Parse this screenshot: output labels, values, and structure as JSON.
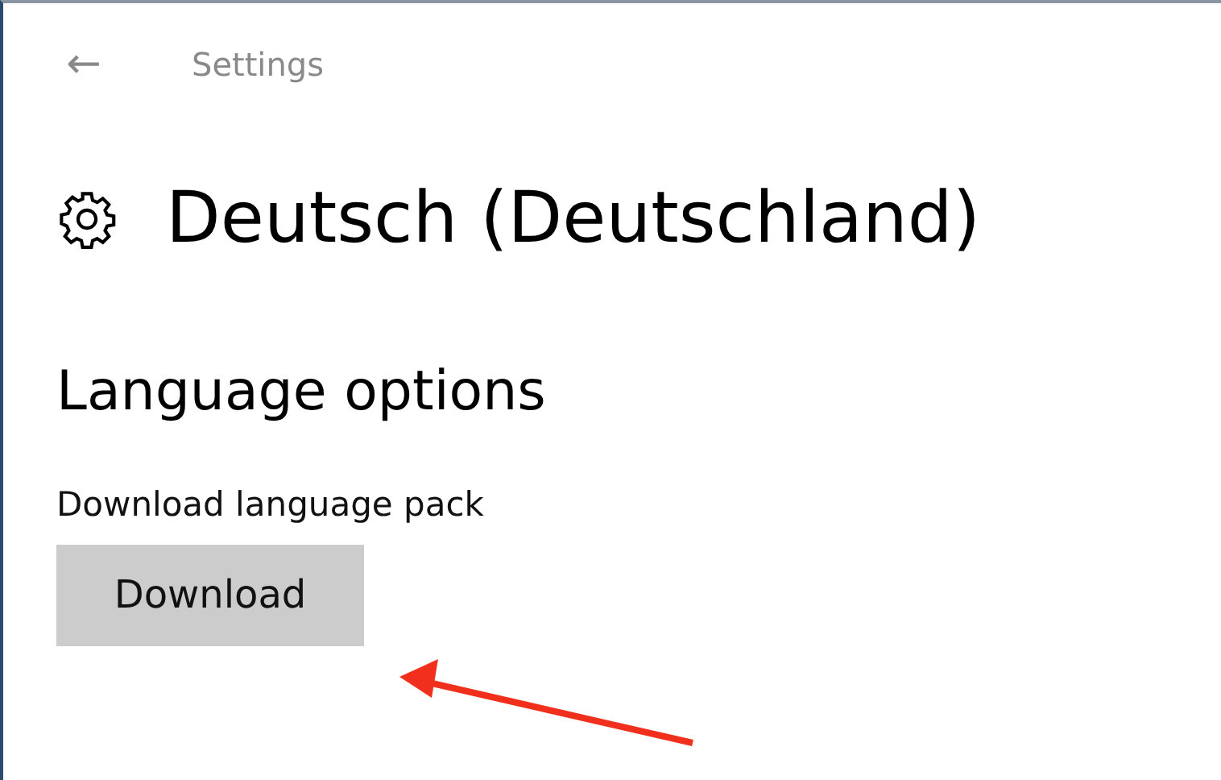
{
  "header": {
    "back": "←",
    "title": "Settings"
  },
  "page": {
    "title": "Deutsch (Deutschland)"
  },
  "section": {
    "heading": "Language options",
    "label": "Download language pack",
    "button": "Download"
  }
}
